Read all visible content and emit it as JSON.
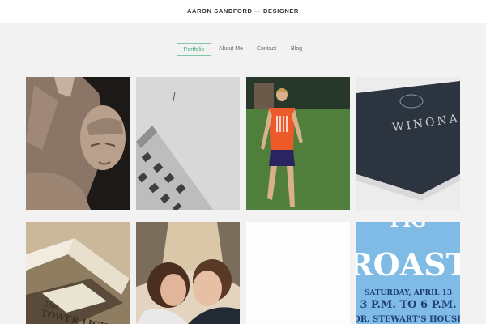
{
  "site": {
    "title": "AARON SANDFORD — DESIGNER"
  },
  "nav": {
    "items": [
      {
        "label": "Portfolio",
        "active": true
      },
      {
        "label": "About Me",
        "active": false
      },
      {
        "label": "Contact",
        "active": false
      },
      {
        "label": "Blog",
        "active": false
      }
    ]
  },
  "colors": {
    "accent": "#3ea97c",
    "background": "#f2f2f2",
    "header": "#ffffff"
  },
  "portfolio": {
    "items": [
      {
        "image": "clay-sculpture-face"
      },
      {
        "image": "building-corner-sky"
      },
      {
        "image": "runner-on-grass"
      },
      {
        "image": "winona-book"
      },
      {
        "image": "tower-light-books"
      },
      {
        "image": "couple-portrait"
      },
      {
        "image": "blank-white"
      },
      {
        "image": "roast-poster"
      }
    ],
    "book_title": "WINONA",
    "book2_title_line1": "The",
    "book2_title_line2": "TOWER LIGHT",
    "poster": {
      "partial_top": "FIG",
      "headline": "ROAST",
      "line1": "SATURDAY, APRIL 13",
      "line2": "3 P.M. TO 6 P.M.",
      "line3": "DR. STEWART'S HOUSE"
    }
  }
}
